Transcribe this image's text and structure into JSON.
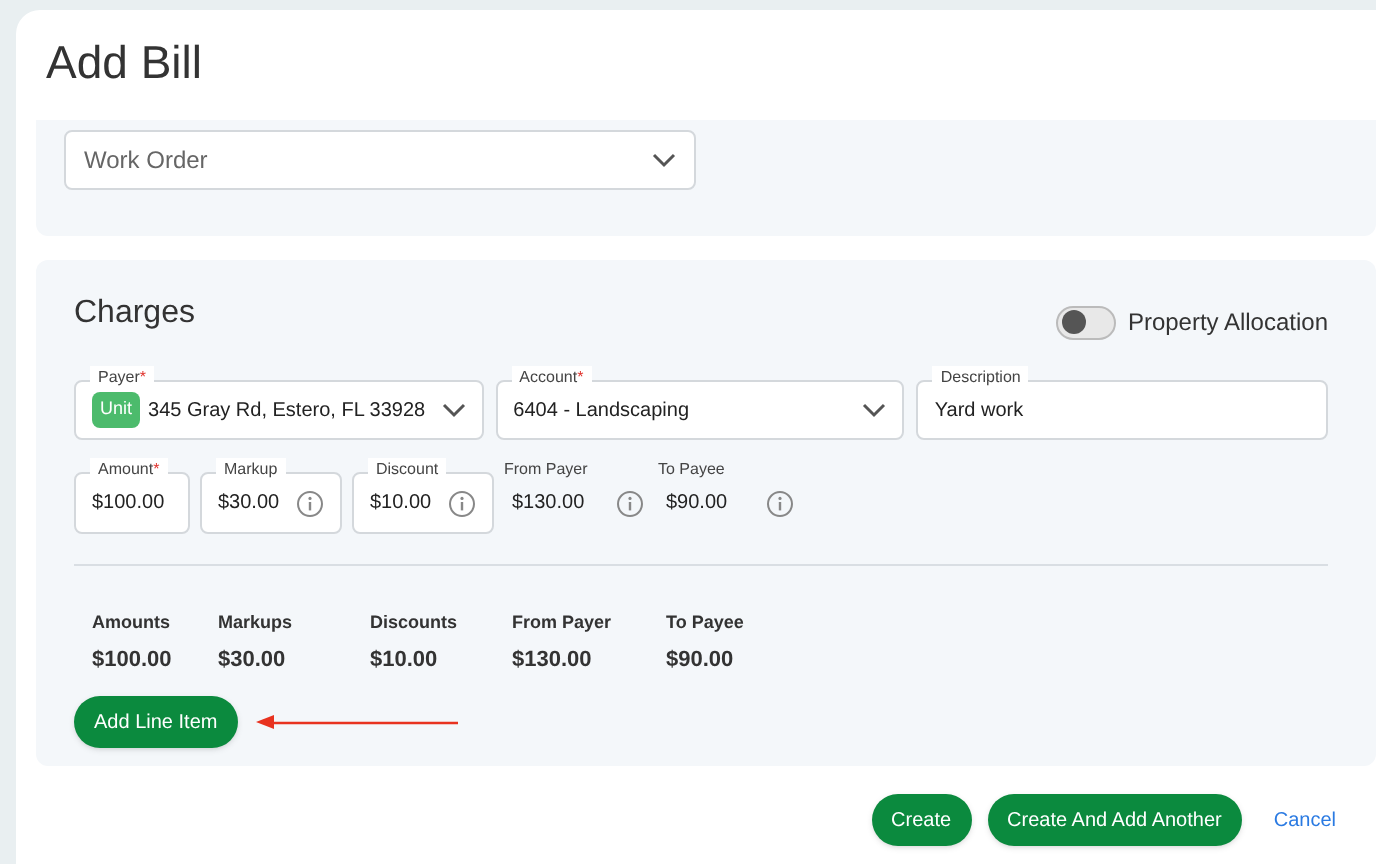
{
  "title": "Add Bill",
  "work_order": {
    "placeholder": "Work Order"
  },
  "charges": {
    "title": "Charges",
    "toggle": {
      "label": "Property Allocation",
      "on": false
    },
    "row1": [
      {
        "kind": "select",
        "label": "Payer",
        "mark": "*",
        "badge": "Unit",
        "value": "345 Gray Rd, Estero, FL 33928"
      },
      {
        "kind": "select",
        "label": "Account",
        "mark": "*",
        "value": "6404 - Landscaping"
      },
      {
        "kind": "text",
        "label": "Description",
        "value": "Yard work"
      }
    ],
    "row2": [
      {
        "kind": "input",
        "label": "Amount",
        "mark": "*",
        "value": "$100.00",
        "info": false
      },
      {
        "kind": "input",
        "label": "Markup",
        "value": "$30.00",
        "info": true
      },
      {
        "kind": "input",
        "label": "Discount",
        "value": "$10.00",
        "info": true
      },
      {
        "kind": "readonly",
        "label": "From Payer",
        "value": "$130.00",
        "info": true
      },
      {
        "kind": "readonly",
        "label": "To Payee",
        "value": "$90.00",
        "info": true
      }
    ],
    "totals": [
      {
        "label": "Amounts",
        "value": "$100.00"
      },
      {
        "label": "Markups",
        "value": "$30.00"
      },
      {
        "label": "Discounts",
        "value": "$10.00"
      },
      {
        "label": "From Payer",
        "value": "$130.00"
      },
      {
        "label": "To Payee",
        "value": "$90.00"
      }
    ],
    "add_button": "Add Line Item"
  },
  "footer": [
    {
      "kind": "primary",
      "label": "Create"
    },
    {
      "kind": "primary",
      "label": "Create And Add Another"
    },
    {
      "kind": "link",
      "label": "Cancel"
    }
  ]
}
